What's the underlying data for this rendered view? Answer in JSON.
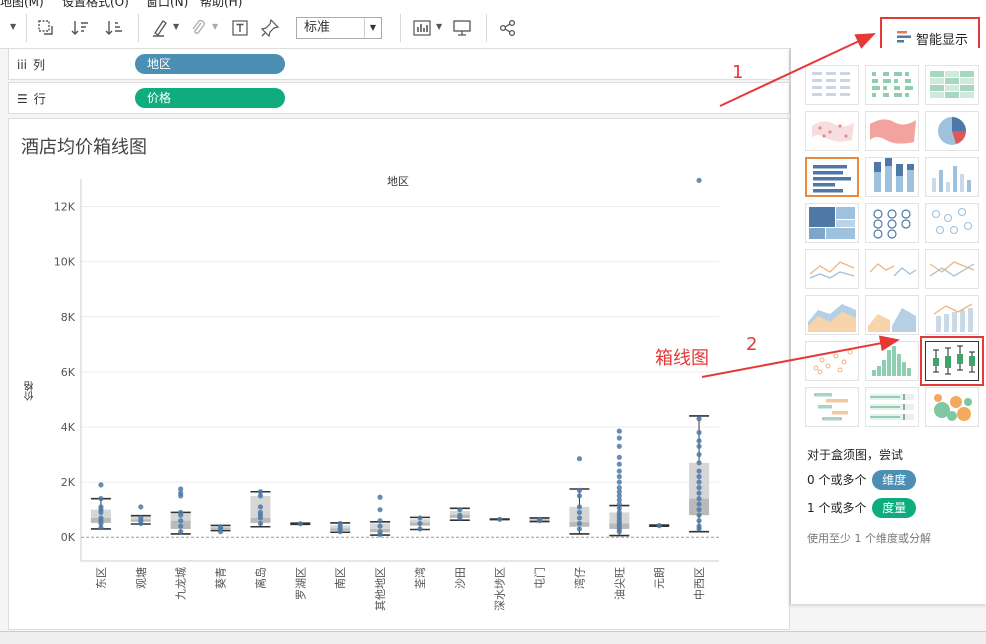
{
  "menu": [
    "地图(M)",
    "设置格式(O)",
    "窗口(N)",
    "帮助(H)"
  ],
  "toolbar": {
    "mark_size_label": "标准",
    "smart_show_label": "智能显示",
    "icons": [
      "swap-rows-cols-icon",
      "sort-ascending-icon",
      "sort-descending-icon",
      "highlight-pen-icon",
      "paperclip-icon",
      "text-label-icon",
      "pin-icon",
      "chart-fit-icon",
      "presentation-icon",
      "share-icon"
    ]
  },
  "shelves": {
    "columns": {
      "label": "列",
      "icon": "columns-icon",
      "pill": "地区",
      "pill_color": "#4b8fb4"
    },
    "rows": {
      "label": "行",
      "icon": "rows-icon",
      "pill": "价格",
      "pill_color": "#0fad7e"
    }
  },
  "viz": {
    "title": "酒店均价箱线图",
    "x_header": "地区"
  },
  "chart_data": {
    "type": "box",
    "title": "酒店均价箱线图",
    "xlabel": "地区",
    "ylabel": "价格",
    "ylim": [
      -500,
      13000
    ],
    "yticks": [
      0,
      2000,
      4000,
      6000,
      8000,
      10000,
      12000
    ],
    "ytick_labels": [
      "0K",
      "2K",
      "4K",
      "6K",
      "8K",
      "10K",
      "12K"
    ],
    "grid": true,
    "categories": [
      "东区",
      "观塘",
      "九龙城",
      "葵青",
      "离岛",
      "罗湖区",
      "南区",
      "其他地区",
      "荃湾",
      "沙田",
      "深水埗区",
      "屯门",
      "湾仔",
      "油尖旺",
      "元朗",
      "中西区"
    ],
    "box_stats": [
      {
        "min": 300,
        "q1": 520,
        "median": 700,
        "q3": 1000,
        "max": 1400
      },
      {
        "min": 480,
        "q1": 560,
        "median": 650,
        "q3": 740,
        "max": 780
      },
      {
        "min": 120,
        "q1": 300,
        "median": 600,
        "q3": 850,
        "max": 900
      },
      {
        "min": 240,
        "q1": 290,
        "median": 350,
        "q3": 400,
        "max": 430
      },
      {
        "min": 380,
        "q1": 520,
        "median": 700,
        "q3": 1500,
        "max": 1650
      },
      {
        "min": 470,
        "q1": 480,
        "median": 490,
        "q3": 500,
        "max": 510
      },
      {
        "min": 180,
        "q1": 230,
        "median": 320,
        "q3": 430,
        "max": 520
      },
      {
        "min": 80,
        "q1": 180,
        "median": 300,
        "q3": 500,
        "max": 560
      },
      {
        "min": 280,
        "q1": 420,
        "median": 540,
        "q3": 650,
        "max": 720
      },
      {
        "min": 620,
        "q1": 700,
        "median": 820,
        "q3": 950,
        "max": 1050
      },
      {
        "min": 640,
        "q1": 645,
        "median": 650,
        "q3": 655,
        "max": 660
      },
      {
        "min": 570,
        "q1": 600,
        "median": 640,
        "q3": 680,
        "max": 700
      },
      {
        "min": 120,
        "q1": 380,
        "median": 550,
        "q3": 1100,
        "max": 1750
      },
      {
        "min": 60,
        "q1": 300,
        "median": 500,
        "q3": 900,
        "max": 1150
      },
      {
        "min": 400,
        "q1": 410,
        "median": 420,
        "q3": 430,
        "max": 440
      },
      {
        "min": 200,
        "q1": 800,
        "median": 1400,
        "q3": 2700,
        "max": 4400
      }
    ],
    "points": [
      [
        1900,
        1400,
        1100,
        1000,
        900,
        700,
        600,
        500,
        350
      ],
      [
        1100,
        700,
        600,
        500
      ],
      [
        1750,
        1600,
        1500,
        900,
        800,
        600,
        400,
        200
      ],
      [
        380,
        300,
        200
      ],
      [
        1650,
        1500,
        1100,
        900,
        800,
        700,
        500
      ],
      [
        490
      ],
      [
        500,
        400,
        300,
        200
      ],
      [
        1450,
        1000,
        600,
        400,
        200,
        100
      ],
      [
        700,
        500,
        300
      ],
      [
        1000,
        800,
        700
      ],
      [
        650
      ],
      [
        650,
        600
      ],
      [
        2850,
        1700,
        1500,
        1100,
        900,
        700,
        500,
        300
      ],
      [
        3850,
        3600,
        3300,
        2900,
        2650,
        2400,
        2200,
        2000,
        1800,
        1650,
        1500,
        1350,
        1200,
        1050,
        900,
        800,
        700,
        600,
        500,
        400,
        300,
        200
      ],
      [
        420
      ],
      [
        12950,
        4300,
        3800,
        3500,
        3300,
        3000,
        2700,
        2400,
        2200,
        2000,
        1800,
        1600,
        1400,
        1200,
        1000,
        800,
        600,
        400,
        300
      ]
    ],
    "mark_color": "#4e79a7",
    "box_color": "#c8c8c8"
  },
  "smart_panel": {
    "hint_title": "对于盒须图，尝试",
    "dims_prefix": "0 个或多个",
    "dims_pill": "维度",
    "dims_color": "#4b8fb4",
    "meas_prefix": "1 个或多个",
    "meas_pill": "度量",
    "meas_color": "#0fad7e",
    "note": "使用至少 1 个维度或分解",
    "thumbs": [
      "text-table",
      "heat-map",
      "highlight-table",
      "symbol-map",
      "filled-map",
      "pie-chart",
      "horizontal-bars",
      "stacked-bars",
      "side-by-side-bars",
      "treemap",
      "circle-views",
      "side-by-side-circles",
      "lines-continuous",
      "lines-discrete",
      "dual-lines",
      "area-continuous",
      "area-discrete",
      "dual-combination",
      "scatter-plot",
      "histogram",
      "box-and-whisker",
      "gantt-chart",
      "bullet-graph",
      "packed-bubbles"
    ]
  },
  "annotations": {
    "step1": "1",
    "step2": "2",
    "box_label": "箱线图"
  }
}
